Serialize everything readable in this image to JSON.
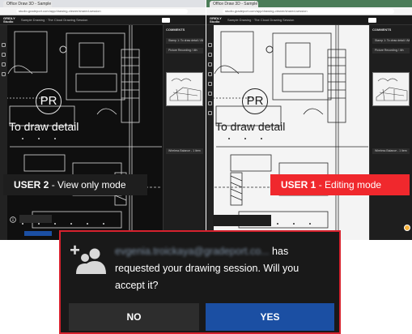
{
  "browser": {
    "tabs": [
      "Office Draw 3D - Sample A1",
      "Office Draw 3D - Sample A1"
    ],
    "address": "studio.gradeport.com/app/drawing-viewer/shared-session"
  },
  "app": {
    "logo_label": "GRIDLY Studio",
    "breadcrumb": "Sample Drawing · The Cloud Drawing Session"
  },
  "left_view": {
    "canvas_text": "To draw detail",
    "pr_label": "PR",
    "mode_user": "USER 2",
    "mode_text": " - View only mode",
    "colors": {
      "canvas": "#0f0f0f",
      "lines": "#d9d9d9",
      "label_bg": "#1e1e1e"
    }
  },
  "right_view": {
    "canvas_text": "To draw detail",
    "pr_label": "PR",
    "mode_user": "USER 1",
    "mode_text": " - Editing mode",
    "colors": {
      "canvas": "#f4f4f4",
      "lines": "#2a2a2a",
      "label_bg": "#f0282d"
    }
  },
  "panel": {
    "heading": "COMMENTS",
    "rows": [
      "Stamp 1: To draw detail / Aiken Chase",
      "Picture Recording / 4th",
      "Wireless Balance - 1 item"
    ]
  },
  "dialog": {
    "email": "evgenia.troickaya@gradeport.co...",
    "message_part1": " has",
    "message_part2": "requested your drawing session. Will you",
    "message_part3": "accept it?",
    "no_label": "NO",
    "yes_label": "YES",
    "icon": "add-user-icon",
    "colors": {
      "border": "#d6222e",
      "no_bg": "#2d2d2d",
      "yes_bg": "#1b4fa3"
    }
  }
}
